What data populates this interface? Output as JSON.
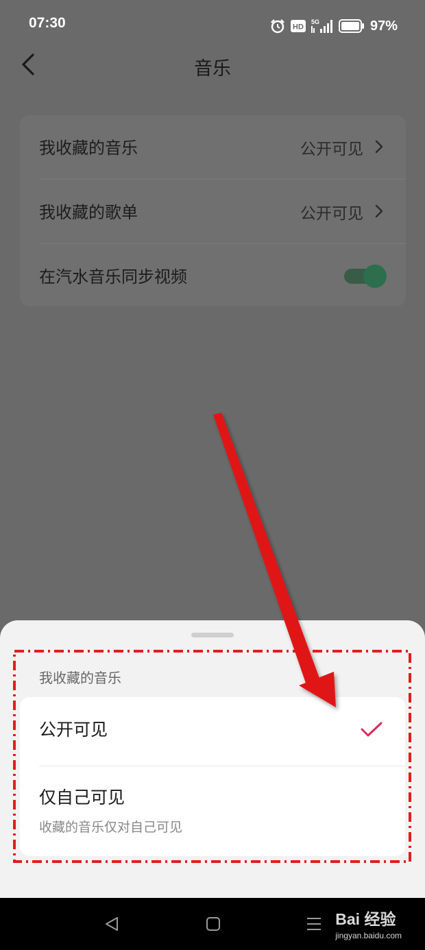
{
  "status_bar": {
    "time": "07:30",
    "network": "5G",
    "hd_badge": "HD",
    "battery": "97%",
    "icons": [
      "alarm-icon",
      "hd-icon",
      "signal-5g-icon",
      "battery-icon"
    ]
  },
  "header": {
    "title": "音乐",
    "back_icon": "chevron-left-icon"
  },
  "settings": {
    "rows": [
      {
        "label": "我收藏的音乐",
        "value": "公开可见"
      },
      {
        "label": "我收藏的歌单",
        "value": "公开可见"
      },
      {
        "label": "在汽水音乐同步视频",
        "toggle_on": true
      }
    ]
  },
  "sheet": {
    "title": "我收藏的音乐",
    "options": [
      {
        "label": "公开可见",
        "selected": true
      },
      {
        "label": "仅自己可见",
        "description": "收藏的音乐仅对自己可见",
        "selected": false
      }
    ]
  },
  "nav": {
    "icons": [
      "back-triangle-icon",
      "home-square-icon",
      "menu-lines-icon"
    ]
  },
  "watermark": {
    "brand": "Bai 经验",
    "url": "jingyan.baidu.com"
  },
  "colors": {
    "dim_background": "#6a6a6a",
    "accent_check": "#e0285a",
    "toggle_green": "#2d6e4c",
    "annotation_red": "#e51c1c"
  }
}
